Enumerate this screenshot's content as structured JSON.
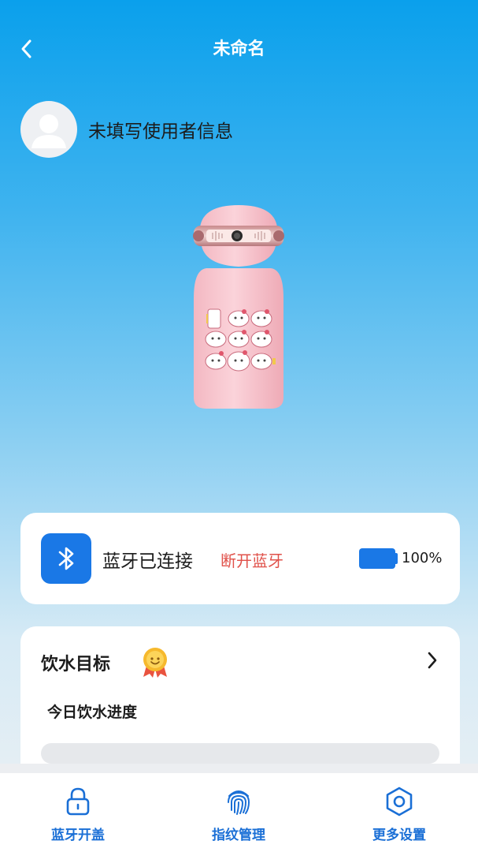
{
  "header": {
    "title": "未命名",
    "back_icon": "chevron-left-icon"
  },
  "user": {
    "avatar_icon": "user-avatar-icon",
    "info_text": "未填写使用者信息"
  },
  "device": {
    "image": "pink-smart-bottle"
  },
  "bluetooth": {
    "icon": "bluetooth-icon",
    "status": "蓝牙已连接",
    "disconnect_label": "断开蓝牙",
    "battery_icon": "battery-icon",
    "battery_level": 1.0,
    "battery_text": "100%"
  },
  "water_goal": {
    "title": "饮水目标",
    "badge_icon": "medal-icon",
    "chevron_icon": "chevron-right-icon",
    "progress_label": "今日饮水进度",
    "progress": 0
  },
  "tabbar": {
    "items": [
      {
        "icon": "lock-icon",
        "label": "蓝牙开盖"
      },
      {
        "icon": "fingerprint-icon",
        "label": "指纹管理"
      },
      {
        "icon": "settings-hexagon-icon",
        "label": "更多设置"
      }
    ]
  },
  "colors": {
    "accent": "#1a78e6",
    "danger": "#e0514a",
    "header_gradient_top": "#0aa0ec"
  }
}
